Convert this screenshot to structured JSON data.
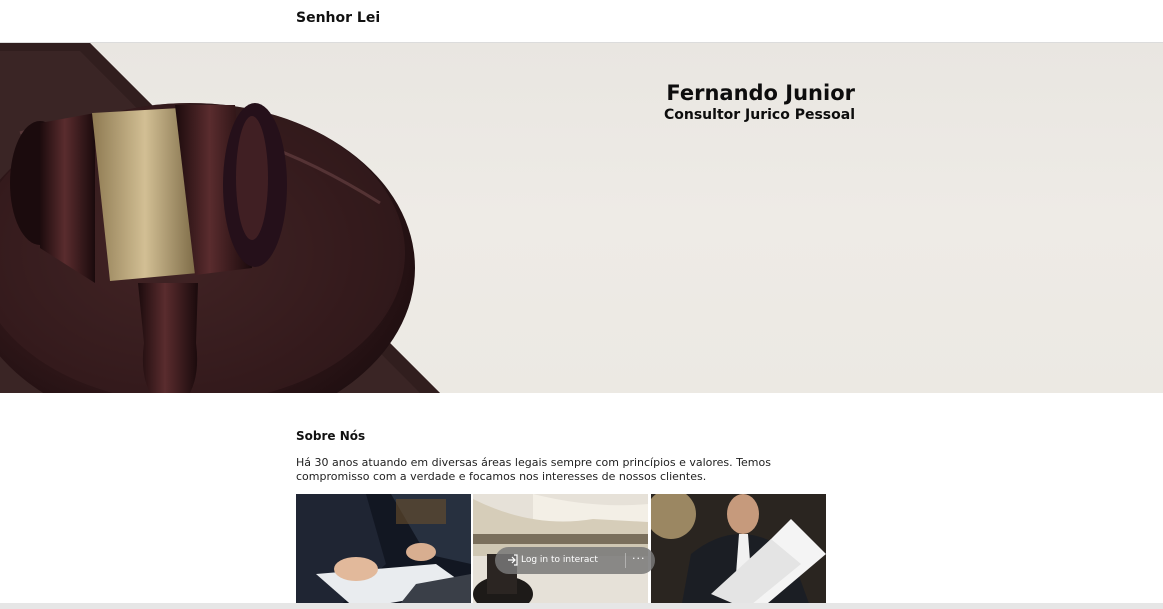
{
  "header": {
    "brand": "Senhor Lei"
  },
  "hero": {
    "title": "Fernando Junior",
    "subtitle": "Consultor Jurico Pessoal"
  },
  "about": {
    "heading": "Sobre Nós",
    "text": "Há 30 anos atuando em diversas áreas legais sempre com princípios e valores. Temos compromisso com a verdade e focamos nos interesses de nossos clientes."
  },
  "overlay": {
    "login_label": "Log in to interact",
    "more_label": "···"
  },
  "icons": {
    "gavel": "gavel-image",
    "login": "login-arrow-icon",
    "more": "more-options-icon"
  }
}
